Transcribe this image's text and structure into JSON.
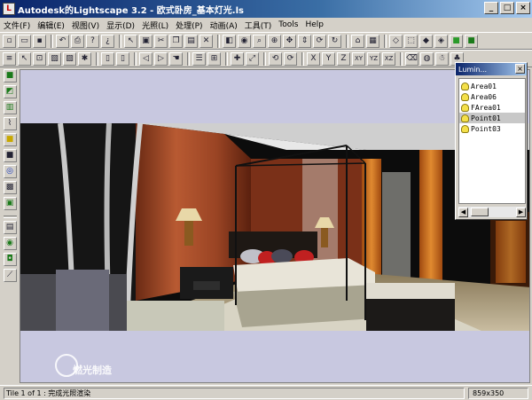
{
  "window": {
    "title": "Autodesk的Lightscape 3.2  - 欧式卧房_基本灯光.ls",
    "buttons": [
      "_",
      "□",
      "×"
    ]
  },
  "menu": [
    "文件(F)",
    "编辑(E)",
    "视图(V)",
    "显示(D)",
    "光照(L)",
    "处理(P)",
    "动画(A)",
    "工具(T)",
    "Tools",
    "Help"
  ],
  "toolbar2_axes": [
    "X",
    "Y",
    "Z",
    "XY",
    "YZ",
    "XZ"
  ],
  "panel": {
    "title": "Lumin...",
    "items": [
      "Area01",
      "Area06",
      "FArea01",
      "Point01",
      "Point03"
    ],
    "selected_index": 3
  },
  "status": {
    "left": "Tile 1 of 1 : 完成光照渲染",
    "size": "859x350"
  },
  "watermark": {
    "text": "燃光制造"
  },
  "colors": {
    "title_start": "#0a246a",
    "title_end": "#a6caf0",
    "viewport_bg": "#c8c8e0",
    "chrome": "#d4d0c8"
  }
}
